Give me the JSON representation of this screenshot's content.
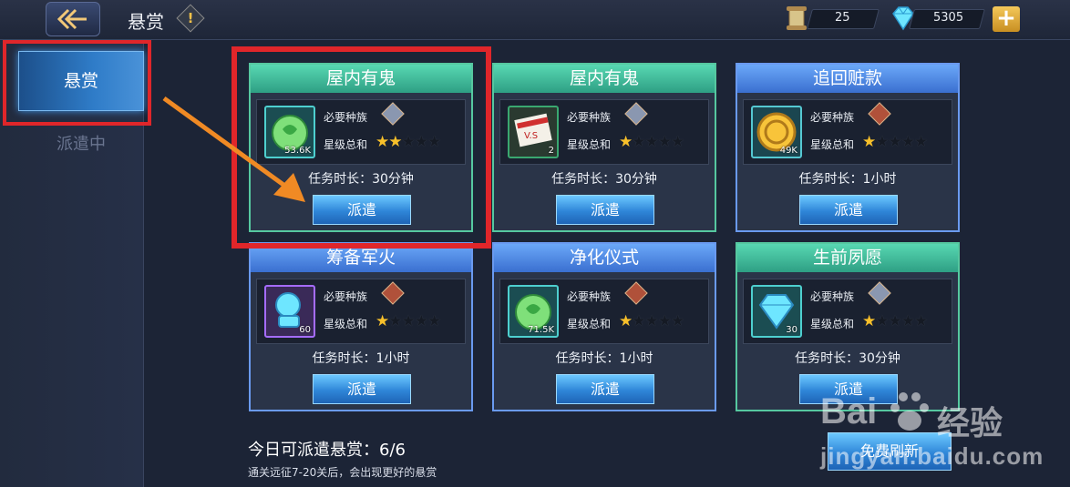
{
  "header": {
    "title": "悬赏",
    "alert_glyph": "!",
    "scroll_count": "25",
    "gem_count": "5305"
  },
  "sidebar": {
    "tabs": [
      {
        "label": "悬赏",
        "active": true
      },
      {
        "label": "派遣中",
        "active": false
      }
    ]
  },
  "cards": [
    {
      "title": "屋内有鬼",
      "theme": "green",
      "item_icon": "green-potion-icon",
      "item_count": "53.6K",
      "req_label": "必要种族",
      "race_icon": "silver-race-icon",
      "star_label": "星级总和",
      "stars": 2,
      "duration": "任务时长：30分钟",
      "button": "派遣"
    },
    {
      "title": "屋内有鬼",
      "theme": "green",
      "item_icon": "vs-ticket-icon",
      "item_count": "2",
      "req_label": "必要种族",
      "race_icon": "silver-race-icon",
      "star_label": "星级总和",
      "stars": 1,
      "duration": "任务时长：30分钟",
      "button": "派遣"
    },
    {
      "title": "追回赃款",
      "theme": "blue",
      "item_icon": "gold-coin-icon",
      "item_count": "49K",
      "req_label": "必要种族",
      "race_icon": "red-race-icon",
      "star_label": "星级总和",
      "stars": 1,
      "duration": "任务时长：1小时",
      "button": "派遣"
    },
    {
      "title": "筹备军火",
      "theme": "blue",
      "item_icon": "gear-crystal-icon",
      "item_count": "60",
      "req_label": "必要种族",
      "race_icon": "red-race-icon",
      "star_label": "星级总和",
      "stars": 1,
      "duration": "任务时长：1小时",
      "button": "派遣"
    },
    {
      "title": "净化仪式",
      "theme": "blue",
      "item_icon": "green-potion-icon",
      "item_count": "71.5K",
      "req_label": "必要种族",
      "race_icon": "red-race-icon",
      "star_label": "星级总和",
      "stars": 1,
      "duration": "任务时长：1小时",
      "button": "派遣"
    },
    {
      "title": "生前夙愿",
      "theme": "green",
      "item_icon": "diamond-icon",
      "item_count": "30",
      "req_label": "必要种族",
      "race_icon": "silver-race-icon",
      "star_label": "星级总和",
      "stars": 1,
      "duration": "任务时长：30分钟",
      "button": "派遣"
    }
  ],
  "footer": {
    "daily_label": "今日可派遣悬赏：6/6",
    "hint": "通关远征7-20关后，会出现更好的悬赏",
    "refresh_button": "免费刷新"
  },
  "watermark": {
    "logo": "Bai",
    "cn": "经验",
    "url": "jingyan.baidu.com"
  },
  "colors": {
    "annotation_red": "#e0262a",
    "annotation_arrow": "#f08a24",
    "star_gold": "#f8c02a"
  }
}
